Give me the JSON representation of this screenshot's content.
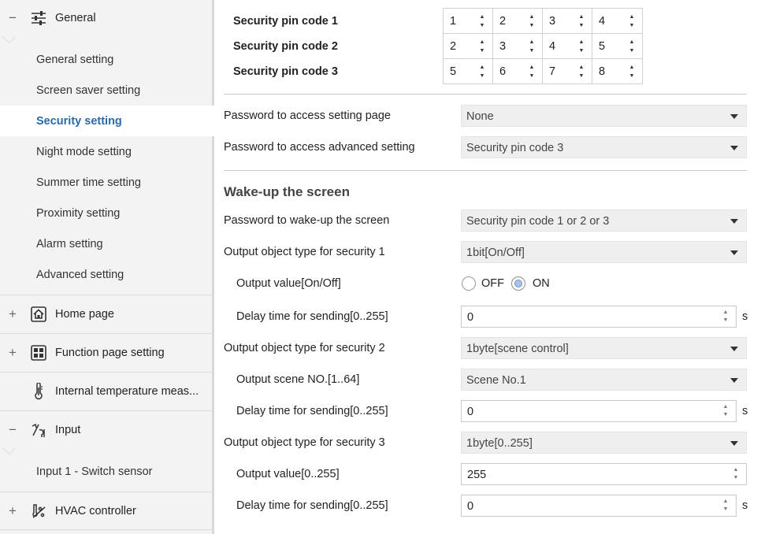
{
  "sidebar": {
    "general": {
      "sign": "−",
      "label": "General"
    },
    "general_items": [
      "General setting",
      "Screen saver setting",
      "Security setting",
      "Night mode setting",
      "Summer time setting",
      "Proximity setting",
      "Alarm setting",
      "Advanced setting"
    ],
    "active_item": "Security setting",
    "home_page": {
      "sign": "+",
      "label": "Home page"
    },
    "function_page": {
      "sign": "+",
      "label": "Function page setting"
    },
    "internal_temp": {
      "label": "Internal temperature meas..."
    },
    "input": {
      "sign": "−",
      "label": "Input"
    },
    "input_items": [
      "Input 1 - Switch sensor"
    ],
    "hvac": {
      "sign": "+",
      "label": "HVAC controller"
    }
  },
  "main": {
    "pins": {
      "labels": [
        "Security pin code 1",
        "Security pin code 2",
        "Security pin code 3"
      ],
      "rows": [
        [
          "1",
          "2",
          "3",
          "4"
        ],
        [
          "2",
          "3",
          "4",
          "5"
        ],
        [
          "5",
          "6",
          "7",
          "8"
        ]
      ]
    },
    "pwd_setting": {
      "label": "Password to access setting page",
      "value": "None"
    },
    "pwd_advanced": {
      "label": "Password to access advanced setting",
      "value": "Security pin code 3"
    },
    "wake_title": "Wake-up the screen",
    "pwd_wake": {
      "label": "Password to wake-up the screen",
      "value": "Security pin code 1 or 2 or 3"
    },
    "sec1_type": {
      "label": "Output object type for security 1",
      "value": "1bit[On/Off]"
    },
    "sec1_value": {
      "label": "Output value[On/Off]",
      "off": "OFF",
      "on": "ON",
      "selected": "ON"
    },
    "sec1_delay": {
      "label": "Delay time for sending[0..255]",
      "value": "0",
      "unit": "s"
    },
    "sec2_type": {
      "label": "Output object type for security 2",
      "value": "1byte[scene control]"
    },
    "sec2_scene": {
      "label": "Output scene NO.[1..64]",
      "value": "Scene No.1"
    },
    "sec2_delay": {
      "label": "Delay time for sending[0..255]",
      "value": "0",
      "unit": "s"
    },
    "sec3_type": {
      "label": "Output object type for security 3",
      "value": "1byte[0..255]"
    },
    "sec3_value": {
      "label": "Output value[0..255]",
      "value": "255"
    },
    "sec3_delay": {
      "label": "Delay time for sending[0..255]",
      "value": "0",
      "unit": "s"
    }
  }
}
